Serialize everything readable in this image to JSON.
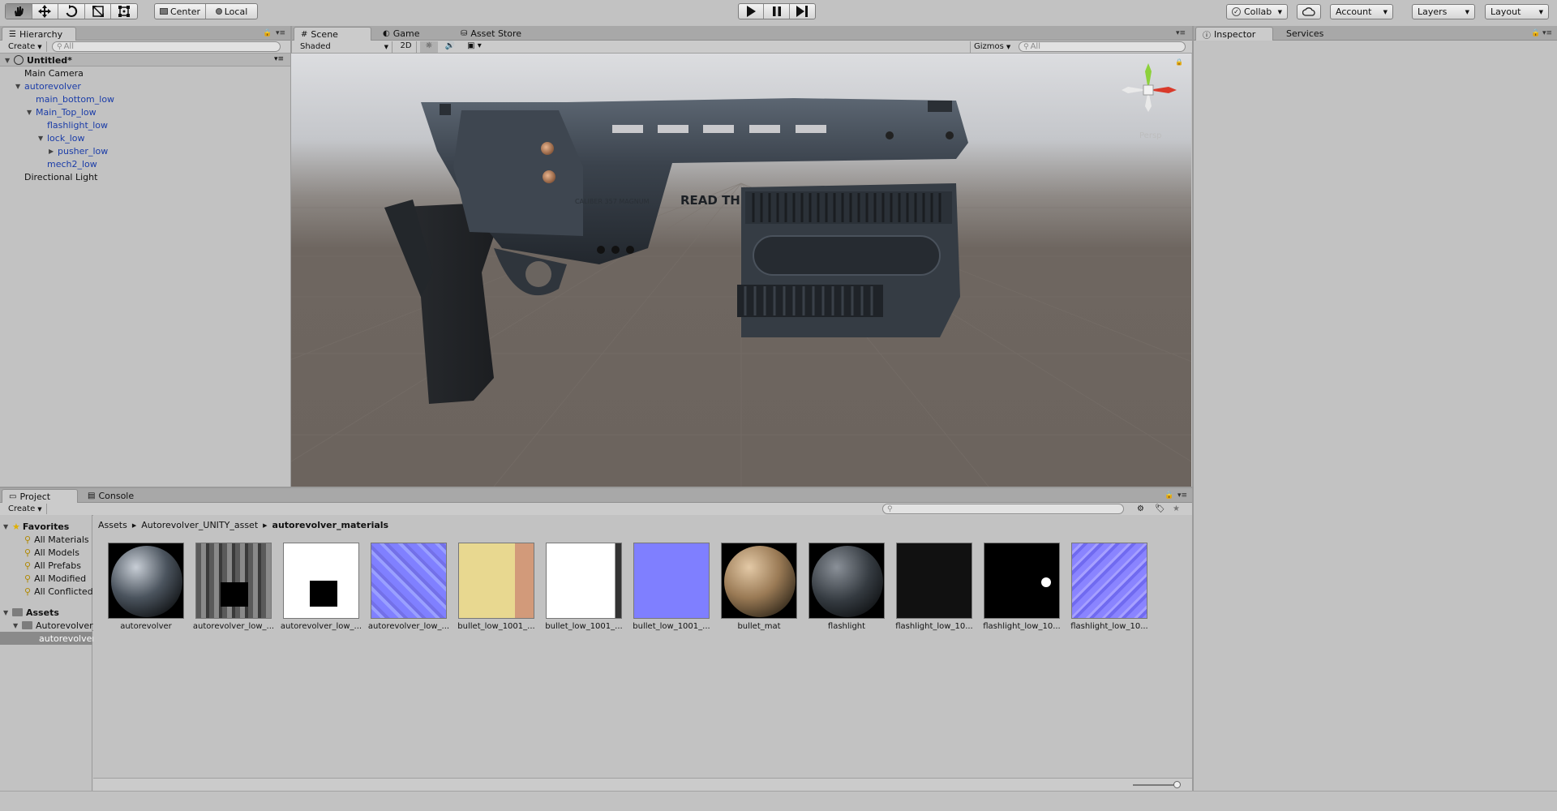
{
  "toolbar": {
    "tools": [
      "hand-icon",
      "move-icon",
      "rotate-icon",
      "scale-icon",
      "rect-icon"
    ],
    "pivot_label": "Center",
    "space_label": "Local",
    "collab_label": "Collab",
    "account_label": "Account",
    "layers_label": "Layers",
    "layout_label": "Layout"
  },
  "hierarchy": {
    "tab_label": "Hierarchy",
    "create_label": "Create",
    "search_placeholder": "All",
    "scene_name": "Untitled*",
    "items": [
      {
        "label": "Main Camera"
      },
      {
        "label": "autorevolver"
      },
      {
        "label": "main_bottom_low"
      },
      {
        "label": "Main_Top_low"
      },
      {
        "label": "flashlight_low"
      },
      {
        "label": "lock_low"
      },
      {
        "label": "pusher_low"
      },
      {
        "label": "mech2_low"
      },
      {
        "label": "Directional Light"
      }
    ]
  },
  "scene": {
    "tabs": [
      {
        "label": "Scene"
      },
      {
        "label": "Game"
      },
      {
        "label": "Asset Store"
      }
    ],
    "shading_mode": "Shaded",
    "mode_2d_label": "2D",
    "gizmos_label": "Gizmos",
    "search_placeholder": "All",
    "persp_label": "Persp",
    "model_engraving": "READ TH",
    "model_caliber": "CALIBER 357 MAGNUM"
  },
  "inspector": {
    "tabs": [
      {
        "label": "Inspector"
      },
      {
        "label": "Services"
      }
    ]
  },
  "project": {
    "tabs": [
      {
        "label": "Project"
      },
      {
        "label": "Console"
      }
    ],
    "create_label": "Create",
    "favorites_label": "Favorites",
    "favorites": [
      {
        "label": "All Materials"
      },
      {
        "label": "All Models"
      },
      {
        "label": "All Prefabs"
      },
      {
        "label": "All Modified"
      },
      {
        "label": "All Conflicted"
      }
    ],
    "assets_label": "Assets",
    "tree": [
      {
        "label": "Autorevolver_UNITY_asset"
      },
      {
        "label": "autorevolver_materials"
      }
    ],
    "breadcrumb": [
      "Assets",
      "Autorevolver_UNITY_asset",
      "autorevolver_materials"
    ],
    "assets": [
      {
        "label": "autorevolver"
      },
      {
        "label": "autorevolver_low_..."
      },
      {
        "label": "autorevolver_low_..."
      },
      {
        "label": "autorevolver_low_..."
      },
      {
        "label": "bullet_low_1001_..."
      },
      {
        "label": "bullet_low_1001_..."
      },
      {
        "label": "bullet_low_1001_..."
      },
      {
        "label": "bullet_mat"
      },
      {
        "label": "flashlight"
      },
      {
        "label": "flashlight_low_10..."
      },
      {
        "label": "flashlight_low_10..."
      },
      {
        "label": "flashlight_low_10..."
      }
    ]
  },
  "colors": {
    "panel_bg": "#c2c2c2",
    "hierarchy_prefab_blue": "#1a3ca8",
    "normal_map": "#8080ff",
    "gizmo_x": "#d93a2a",
    "gizmo_y": "#8dd13a"
  }
}
